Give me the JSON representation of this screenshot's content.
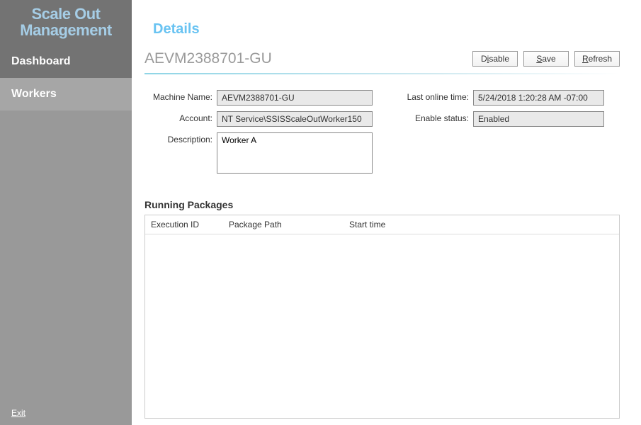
{
  "sidebar": {
    "title_line1": "Scale Out",
    "title_line2": "Management",
    "items": [
      {
        "label": "Dashboard"
      },
      {
        "label": "Workers"
      }
    ],
    "exit_label": "Exit"
  },
  "header": {
    "details_title": "Details",
    "machine_title": "AEVM2388701-GU",
    "buttons": {
      "disable_pre": "D",
      "disable_ul": "i",
      "disable_post": "sable",
      "save_pre": "",
      "save_ul": "S",
      "save_post": "ave",
      "refresh_pre": "",
      "refresh_ul": "R",
      "refresh_post": "efresh"
    }
  },
  "form": {
    "machine_name_label": "Machine Name:",
    "machine_name_value": "AEVM2388701-GU",
    "account_label": "Account:",
    "account_value": "NT Service\\SSISScaleOutWorker150",
    "description_label": "Description:",
    "description_value": "Worker A",
    "last_online_label": "Last online time:",
    "last_online_value": "5/24/2018 1:20:28 AM -07:00",
    "enable_status_label": "Enable status:",
    "enable_status_value": "Enabled"
  },
  "packages": {
    "section_title": "Running Packages",
    "columns": {
      "execution_id": "Execution ID",
      "package_path": "Package Path",
      "start_time": "Start time"
    },
    "rows": []
  }
}
